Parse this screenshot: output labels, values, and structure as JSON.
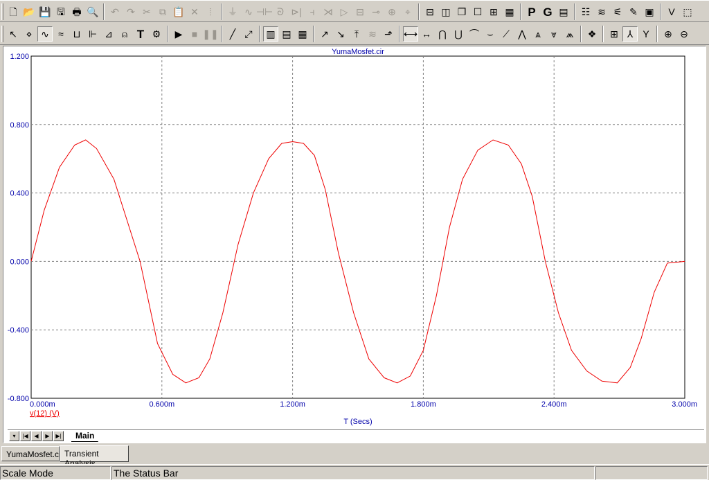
{
  "toolbar1": {
    "buttons": [
      {
        "name": "new-file-icon",
        "glyph": "🗋",
        "enabled": true
      },
      {
        "name": "open-folder-icon",
        "glyph": "📂",
        "enabled": true
      },
      {
        "name": "save-icon",
        "glyph": "💾",
        "enabled": true
      },
      {
        "name": "save-all-icon",
        "glyph": "🖫",
        "enabled": true
      },
      {
        "name": "print-icon",
        "glyph": "🖶",
        "enabled": true
      },
      {
        "name": "print-preview-icon",
        "glyph": "🔍",
        "enabled": true
      },
      {
        "name": "undo-icon",
        "glyph": "↶",
        "enabled": false
      },
      {
        "name": "redo-icon",
        "glyph": "↷",
        "enabled": false
      },
      {
        "name": "cut-icon",
        "glyph": "✂",
        "enabled": false
      },
      {
        "name": "copy-icon",
        "glyph": "⧉",
        "enabled": false
      },
      {
        "name": "paste-icon",
        "glyph": "📋",
        "enabled": false
      },
      {
        "name": "delete-icon",
        "glyph": "✕",
        "enabled": false
      },
      {
        "name": "select-all-icon",
        "glyph": "⦙",
        "enabled": false
      },
      {
        "name": "ground-icon",
        "glyph": "⏚",
        "enabled": false
      },
      {
        "name": "resistor-icon",
        "glyph": "∿",
        "enabled": false
      },
      {
        "name": "capacitor-icon",
        "glyph": "⊣⊢",
        "enabled": false
      },
      {
        "name": "inductor-icon",
        "glyph": "ᘐ",
        "enabled": false
      },
      {
        "name": "diode-icon",
        "glyph": "⊳|",
        "enabled": false
      },
      {
        "name": "transistor-icon",
        "glyph": "⫞",
        "enabled": false
      },
      {
        "name": "bipolar-icon",
        "glyph": "⋊",
        "enabled": false
      },
      {
        "name": "opamp-icon",
        "glyph": "▷",
        "enabled": false
      },
      {
        "name": "battery-icon",
        "glyph": "⊟",
        "enabled": false
      },
      {
        "name": "switch-icon",
        "glyph": "⊸",
        "enabled": false
      },
      {
        "name": "source-icon",
        "glyph": "⊕",
        "enabled": false
      },
      {
        "name": "probe-icon",
        "glyph": "⌖",
        "enabled": false
      },
      {
        "name": "split-horizontal-icon",
        "glyph": "⊟",
        "enabled": true
      },
      {
        "name": "split-vertical-icon",
        "glyph": "◫",
        "enabled": true
      },
      {
        "name": "cascade-icon",
        "glyph": "❐",
        "enabled": true
      },
      {
        "name": "window-icon",
        "glyph": "☐",
        "enabled": true
      },
      {
        "name": "tile-icon",
        "glyph": "⊞",
        "enabled": true
      },
      {
        "name": "calculator-icon",
        "glyph": "▦",
        "enabled": true
      },
      {
        "name": "p-icon",
        "glyph": "P",
        "enabled": true,
        "letter": true
      },
      {
        "name": "g-icon",
        "glyph": "G",
        "enabled": true,
        "letter": true
      },
      {
        "name": "component-editor-icon",
        "glyph": "▤",
        "enabled": true
      },
      {
        "name": "shape-editor-icon",
        "glyph": "☷",
        "enabled": true
      },
      {
        "name": "waveform-icon",
        "glyph": "≋",
        "enabled": true
      },
      {
        "name": "model-icon",
        "glyph": "⚟",
        "enabled": true
      },
      {
        "name": "pen-icon",
        "glyph": "✎",
        "enabled": true
      },
      {
        "name": "scope-icon",
        "glyph": "▣",
        "enabled": true
      },
      {
        "name": "vt-icon",
        "glyph": "V",
        "enabled": true
      },
      {
        "name": "plot-icon",
        "glyph": "⬚",
        "enabled": true
      }
    ]
  },
  "toolbar2": {
    "buttons": [
      {
        "name": "select-mode-icon",
        "glyph": "↖",
        "pressed": false
      },
      {
        "name": "point-mode-icon",
        "glyph": "⋄",
        "pressed": false
      },
      {
        "name": "scale-mode-icon",
        "glyph": "∿",
        "pressed": true
      },
      {
        "name": "cursor-mode-icon",
        "glyph": "≈",
        "pressed": false
      },
      {
        "name": "horizontal-tag-icon",
        "glyph": "⊔",
        "pressed": false
      },
      {
        "name": "vertical-tag-icon",
        "glyph": "⊩",
        "pressed": false
      },
      {
        "name": "point-tag-icon",
        "glyph": "⊿",
        "pressed": false
      },
      {
        "name": "performance-tag-icon",
        "glyph": "⍝",
        "pressed": false
      },
      {
        "name": "text-icon",
        "glyph": "T",
        "pressed": false,
        "letter": true
      },
      {
        "name": "properties-icon",
        "glyph": "⚙",
        "pressed": false
      },
      {
        "name": "run-icon",
        "glyph": "▶",
        "pressed": false
      },
      {
        "name": "stop-icon",
        "glyph": "■",
        "pressed": false,
        "dis": true
      },
      {
        "name": "pause-icon",
        "glyph": "❚❚",
        "pressed": false,
        "dis": true
      },
      {
        "name": "line-icon",
        "glyph": "╱",
        "pressed": false
      },
      {
        "name": "arrow-line-icon",
        "glyph": "⤢",
        "pressed": false
      },
      {
        "name": "grid-icon",
        "glyph": "▥",
        "pressed": true
      },
      {
        "name": "minor-grid-icon",
        "glyph": "▤",
        "pressed": false
      },
      {
        "name": "dot-grid-icon",
        "glyph": "▦",
        "pressed": false
      },
      {
        "name": "peak-icon",
        "glyph": "↗",
        "pressed": false
      },
      {
        "name": "valley-icon",
        "glyph": "↘",
        "pressed": false
      },
      {
        "name": "high-icon",
        "glyph": "⤒",
        "pressed": false
      },
      {
        "name": "low-icon",
        "glyph": "≋",
        "pressed": false,
        "dis": true
      },
      {
        "name": "scale-plot-icon",
        "glyph": "⬏",
        "pressed": false
      },
      {
        "name": "cursor-left-icon",
        "glyph": "⟷",
        "pressed": true
      },
      {
        "name": "cursor-right-icon",
        "glyph": "↔",
        "pressed": false
      },
      {
        "name": "next-peak-icon",
        "glyph": "⋂",
        "pressed": false
      },
      {
        "name": "next-valley-icon",
        "glyph": "⋃",
        "pressed": false
      },
      {
        "name": "next-high-icon",
        "glyph": "⌒",
        "pressed": false
      },
      {
        "name": "next-low-icon",
        "glyph": "⌣",
        "pressed": false
      },
      {
        "name": "slope-icon",
        "glyph": "⟋",
        "pressed": false
      },
      {
        "name": "next-inflection-icon",
        "glyph": "⋀",
        "pressed": false
      },
      {
        "name": "global-high-icon",
        "glyph": "⩓",
        "pressed": false
      },
      {
        "name": "global-low-icon",
        "glyph": "⩔",
        "pressed": false
      },
      {
        "name": "top-icon",
        "glyph": "⩕",
        "pressed": false
      },
      {
        "name": "color-palette-icon",
        "glyph": "❖",
        "pressed": false
      },
      {
        "name": "table-icon",
        "glyph": "⊞",
        "pressed": false
      },
      {
        "name": "label-x-icon",
        "glyph": "⅄",
        "pressed": true
      },
      {
        "name": "label-y-icon",
        "glyph": "Y",
        "pressed": false
      },
      {
        "name": "zoom-in-icon",
        "glyph": "⊕",
        "pressed": false
      },
      {
        "name": "zoom-out-icon",
        "glyph": "⊖",
        "pressed": false
      }
    ]
  },
  "plot": {
    "title": "YumaMosfet.cir",
    "xlabel": "T (Secs)",
    "series_label": "v(12) (V)",
    "colors": {
      "trace": "#ee0000",
      "axis_text": "#0000aa",
      "grid": "#808080"
    }
  },
  "chart_data": {
    "type": "line",
    "title": "YumaMosfet.cir",
    "xlabel": "T (Secs)",
    "ylabel": "",
    "xlim": [
      0,
      0.003
    ],
    "ylim": [
      -0.8,
      1.2
    ],
    "x_ticks": [
      {
        "value": 0,
        "label": "0.000m"
      },
      {
        "value": 0.0006,
        "label": "0.600m"
      },
      {
        "value": 0.0012,
        "label": "1.200m"
      },
      {
        "value": 0.0018,
        "label": "1.800m"
      },
      {
        "value": 0.0024,
        "label": "2.400m"
      },
      {
        "value": 0.003,
        "label": "3.000m"
      }
    ],
    "y_ticks": [
      {
        "value": 1.2,
        "label": "1.200"
      },
      {
        "value": 0.8,
        "label": "0.800"
      },
      {
        "value": 0.4,
        "label": "0.400"
      },
      {
        "value": 0.0,
        "label": "0.000"
      },
      {
        "value": -0.4,
        "label": "-0.400"
      },
      {
        "value": -0.8,
        "label": "-0.800"
      }
    ],
    "grid": true,
    "series": [
      {
        "name": "v(12) (V)",
        "color": "#ee0000",
        "x": [
          0,
          6e-05,
          0.00013,
          0.0002,
          0.00025,
          0.0003,
          0.00038,
          0.00045,
          0.0005,
          0.00058,
          0.00065,
          0.00071,
          0.00077,
          0.00082,
          0.00088,
          0.00095,
          0.00102,
          0.00109,
          0.00115,
          0.0012,
          0.00125,
          0.0013,
          0.00135,
          0.00141,
          0.00148,
          0.00155,
          0.00162,
          0.00168,
          0.00174,
          0.0018,
          0.00186,
          0.00192,
          0.00198,
          0.00205,
          0.00212,
          0.00219,
          0.00225,
          0.0023,
          0.00236,
          0.00242,
          0.00248,
          0.00255,
          0.00262,
          0.00269,
          0.00275,
          0.0028,
          0.00286,
          0.00292,
          0.003
        ],
        "y": [
          0.0,
          0.3,
          0.55,
          0.68,
          0.71,
          0.66,
          0.48,
          0.2,
          0.0,
          -0.48,
          -0.66,
          -0.71,
          -0.68,
          -0.57,
          -0.3,
          0.1,
          0.4,
          0.6,
          0.69,
          0.7,
          0.69,
          0.62,
          0.42,
          0.05,
          -0.3,
          -0.57,
          -0.68,
          -0.71,
          -0.67,
          -0.52,
          -0.2,
          0.2,
          0.48,
          0.65,
          0.71,
          0.68,
          0.57,
          0.38,
          0.0,
          -0.3,
          -0.52,
          -0.64,
          -0.7,
          -0.71,
          -0.62,
          -0.45,
          -0.18,
          -0.01,
          0.0
        ]
      }
    ]
  },
  "sheet": {
    "nav_buttons": [
      "▾",
      "|◀",
      "◀",
      "▶",
      "▶|"
    ],
    "tab_label": "Main"
  },
  "doc_tabs": [
    {
      "label": "YumaMosfet.cir",
      "active": false
    },
    {
      "label": "Transient Analysis",
      "active": true
    }
  ],
  "status": {
    "mode": "Scale Mode",
    "message": "The Status Bar",
    "extra": ""
  }
}
